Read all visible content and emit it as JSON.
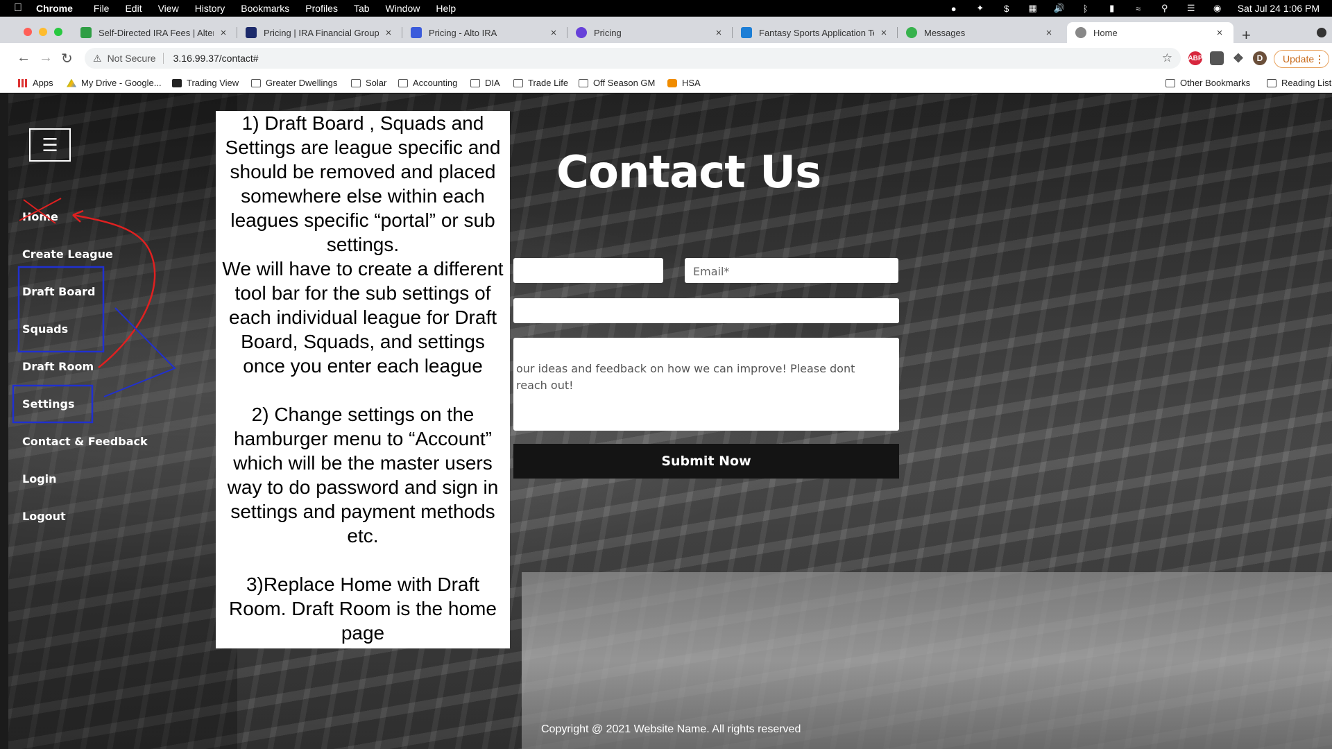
{
  "menubar": {
    "app": "Chrome",
    "items": [
      "File",
      "Edit",
      "View",
      "History",
      "Bookmarks",
      "Profiles",
      "Tab",
      "Window",
      "Help"
    ],
    "datetime": "Sat Jul 24  1:06 PM"
  },
  "tabs": [
    {
      "title": "Self-Directed IRA Fees | Altern",
      "favicon_color": "#2f9e44"
    },
    {
      "title": "Pricing | IRA Financial Group",
      "favicon_color": "#1c2a6b"
    },
    {
      "title": "Pricing - Alto IRA",
      "favicon_color": "#3b5bdb"
    },
    {
      "title": "Pricing",
      "favicon_color": "#6741d9"
    },
    {
      "title": "Fantasy Sports Application Tea",
      "favicon_color": "#1c7ed6"
    },
    {
      "title": "Messages",
      "favicon_color": "#37b24d"
    },
    {
      "title": "Home",
      "favicon_color": "#666666",
      "active": true
    }
  ],
  "toolbar": {
    "security_label": "Not Secure",
    "url": "3.16.99.37/contact#",
    "update_label": "Update",
    "profile_initial": "D",
    "abp_label": "ABP"
  },
  "bookmarks": [
    {
      "label": "Apps",
      "icon": "apps-grid-icon"
    },
    {
      "label": "My Drive - Google...",
      "icon": "google-drive-icon"
    },
    {
      "label": "Trading View",
      "icon": "tradingview-icon"
    },
    {
      "label": "Greater Dwellings",
      "icon": "folder-icon"
    },
    {
      "label": "Solar",
      "icon": "folder-icon"
    },
    {
      "label": "Accounting",
      "icon": "folder-icon"
    },
    {
      "label": "DIA",
      "icon": "folder-icon"
    },
    {
      "label": "Trade Life",
      "icon": "folder-icon"
    },
    {
      "label": "Off Season GM",
      "icon": "folder-icon"
    },
    {
      "label": "HSA",
      "icon": "hsa-icon"
    }
  ],
  "bookmarks_right": [
    "Other Bookmarks",
    "Reading List"
  ],
  "site": {
    "nav": [
      "Home",
      "Create League",
      "Draft Board",
      "Squads",
      "Draft Room",
      "Settings",
      "Contact & Feedback",
      "Login",
      "Logout"
    ],
    "title": "Contact Us",
    "email_placeholder": "Email*",
    "message_text": "our ideas and feedback on how we can improve! Please dont\n reach out!",
    "submit_label": "Submit Now",
    "copyright": "Copyright @ 2021 Website Name. All rights reserved"
  },
  "note": "1) Draft Board , Squads and Settings are league specific and should be removed and placed somewhere else within each leagues specific “portal” or sub settings.\nWe will have to create a different tool bar for the sub settings of each individual league for Draft Board, Squads, and settings once you enter each league\n\n2) Change settings on the hamburger menu to “Account” which will be the master users way to do password and  sign in settings and payment methods etc.\n\n3)Replace Home with Draft Room. Draft Room is the home page",
  "colors": {
    "annotation_red": "#e02020",
    "annotation_blue": "#2030d0",
    "submit_bg": "#141414"
  }
}
